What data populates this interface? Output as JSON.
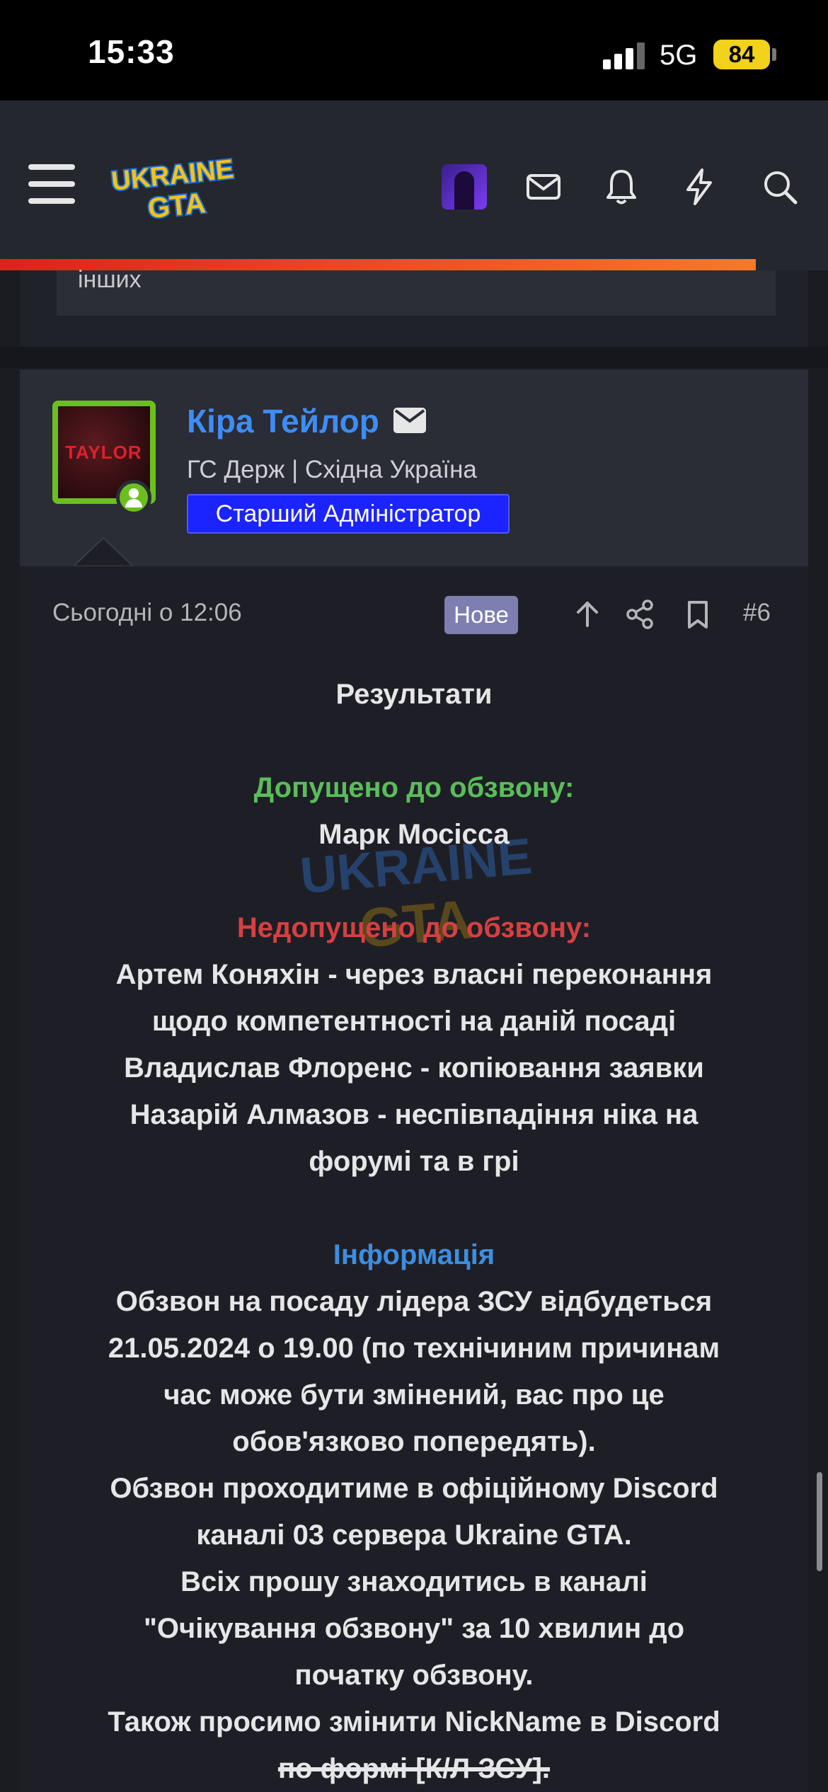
{
  "status_bar": {
    "time": "15:33",
    "network": "5G",
    "battery": "84"
  },
  "header": {
    "logo_top": "UKRAINE",
    "logo_bottom": "GTA",
    "icons": [
      "menu-icon",
      "mail-icon",
      "bell-icon",
      "lightning-icon",
      "search-icon"
    ]
  },
  "previous_post": {
    "snippet": "інших"
  },
  "post": {
    "author": {
      "name": "Кіра Тейлор",
      "avatar_text": "TAYLOR",
      "title": "ГС Держ | Східна Україна",
      "role": "Старший Адміністратор"
    },
    "date": "Сьогодні о 12:06",
    "badge": "Нове",
    "number": "#6",
    "body": {
      "heading": "Результати",
      "admitted_label": "Допущено до обзвону:",
      "admitted": [
        "Марк Мосісса"
      ],
      "rejected_label": "Недопущено до обзвону:",
      "rejected": [
        "Артем Коняхін - через власні переконання",
        "щодо компетентності на даній посаді",
        "Владислав Флоренс - копіювання заявки",
        "Назарій Алмазов - неспівпадіння ніка на",
        "форумі та в грі"
      ],
      "info_label": "Інформація",
      "info": [
        "Обзвон на посаду лідера ЗСУ відбудеться",
        "21.05.2024 о 19.00 (по технічиним причинам",
        "час може бути змінений, вас про це",
        "обов'язково попередять).",
        "Обзвон проходитиме в офіційному Discord",
        "каналі 03 сервера Ukraine GTA.",
        "Всіх прошу знаходитись в каналі",
        "\"Очікування обзвону\" за 10 хвилин до",
        "початку обзвону.",
        "Також просимо змінити NickName в Discord"
      ],
      "last_line": "по формі [К/Л ЗСУ]."
    }
  },
  "colors": {
    "background": "#1b1c22",
    "header": "#25272f",
    "accent_red": "#e0201b",
    "accent_orange": "#f47a2a",
    "link_blue": "#3d8df5",
    "role_blue": "#1b23ff",
    "green": "#5abd5a",
    "red": "#d64040",
    "info_blue": "#3d8ee0",
    "avatar_border": "#6bbf1f"
  }
}
